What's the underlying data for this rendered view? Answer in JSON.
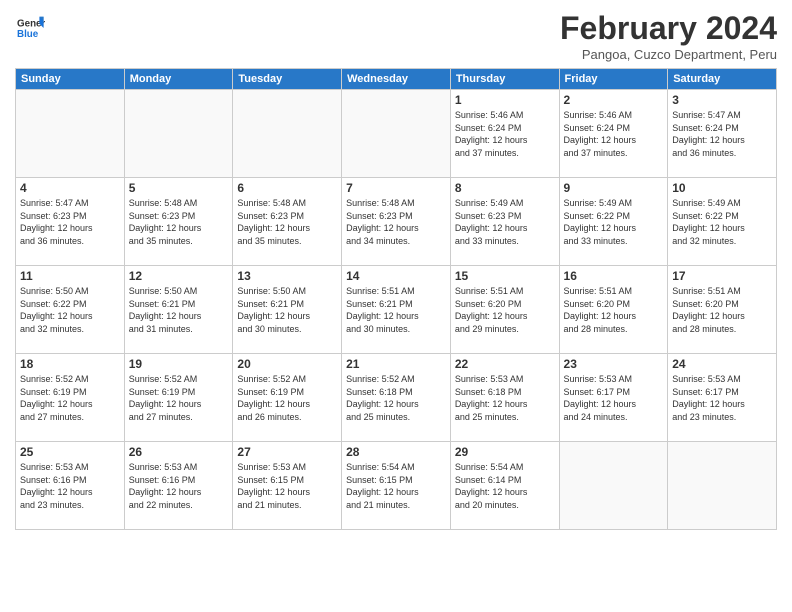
{
  "logo": {
    "line1": "General",
    "line2": "Blue",
    "icon_color": "#1a73d9"
  },
  "title": "February 2024",
  "subtitle": "Pangoa, Cuzco Department, Peru",
  "days_of_week": [
    "Sunday",
    "Monday",
    "Tuesday",
    "Wednesday",
    "Thursday",
    "Friday",
    "Saturday"
  ],
  "weeks": [
    [
      {
        "day": "",
        "info": ""
      },
      {
        "day": "",
        "info": ""
      },
      {
        "day": "",
        "info": ""
      },
      {
        "day": "",
        "info": ""
      },
      {
        "day": "1",
        "info": "Sunrise: 5:46 AM\nSunset: 6:24 PM\nDaylight: 12 hours\nand 37 minutes."
      },
      {
        "day": "2",
        "info": "Sunrise: 5:46 AM\nSunset: 6:24 PM\nDaylight: 12 hours\nand 37 minutes."
      },
      {
        "day": "3",
        "info": "Sunrise: 5:47 AM\nSunset: 6:24 PM\nDaylight: 12 hours\nand 36 minutes."
      }
    ],
    [
      {
        "day": "4",
        "info": "Sunrise: 5:47 AM\nSunset: 6:23 PM\nDaylight: 12 hours\nand 36 minutes."
      },
      {
        "day": "5",
        "info": "Sunrise: 5:48 AM\nSunset: 6:23 PM\nDaylight: 12 hours\nand 35 minutes."
      },
      {
        "day": "6",
        "info": "Sunrise: 5:48 AM\nSunset: 6:23 PM\nDaylight: 12 hours\nand 35 minutes."
      },
      {
        "day": "7",
        "info": "Sunrise: 5:48 AM\nSunset: 6:23 PM\nDaylight: 12 hours\nand 34 minutes."
      },
      {
        "day": "8",
        "info": "Sunrise: 5:49 AM\nSunset: 6:23 PM\nDaylight: 12 hours\nand 33 minutes."
      },
      {
        "day": "9",
        "info": "Sunrise: 5:49 AM\nSunset: 6:22 PM\nDaylight: 12 hours\nand 33 minutes."
      },
      {
        "day": "10",
        "info": "Sunrise: 5:49 AM\nSunset: 6:22 PM\nDaylight: 12 hours\nand 32 minutes."
      }
    ],
    [
      {
        "day": "11",
        "info": "Sunrise: 5:50 AM\nSunset: 6:22 PM\nDaylight: 12 hours\nand 32 minutes."
      },
      {
        "day": "12",
        "info": "Sunrise: 5:50 AM\nSunset: 6:21 PM\nDaylight: 12 hours\nand 31 minutes."
      },
      {
        "day": "13",
        "info": "Sunrise: 5:50 AM\nSunset: 6:21 PM\nDaylight: 12 hours\nand 30 minutes."
      },
      {
        "day": "14",
        "info": "Sunrise: 5:51 AM\nSunset: 6:21 PM\nDaylight: 12 hours\nand 30 minutes."
      },
      {
        "day": "15",
        "info": "Sunrise: 5:51 AM\nSunset: 6:20 PM\nDaylight: 12 hours\nand 29 minutes."
      },
      {
        "day": "16",
        "info": "Sunrise: 5:51 AM\nSunset: 6:20 PM\nDaylight: 12 hours\nand 28 minutes."
      },
      {
        "day": "17",
        "info": "Sunrise: 5:51 AM\nSunset: 6:20 PM\nDaylight: 12 hours\nand 28 minutes."
      }
    ],
    [
      {
        "day": "18",
        "info": "Sunrise: 5:52 AM\nSunset: 6:19 PM\nDaylight: 12 hours\nand 27 minutes."
      },
      {
        "day": "19",
        "info": "Sunrise: 5:52 AM\nSunset: 6:19 PM\nDaylight: 12 hours\nand 27 minutes."
      },
      {
        "day": "20",
        "info": "Sunrise: 5:52 AM\nSunset: 6:19 PM\nDaylight: 12 hours\nand 26 minutes."
      },
      {
        "day": "21",
        "info": "Sunrise: 5:52 AM\nSunset: 6:18 PM\nDaylight: 12 hours\nand 25 minutes."
      },
      {
        "day": "22",
        "info": "Sunrise: 5:53 AM\nSunset: 6:18 PM\nDaylight: 12 hours\nand 25 minutes."
      },
      {
        "day": "23",
        "info": "Sunrise: 5:53 AM\nSunset: 6:17 PM\nDaylight: 12 hours\nand 24 minutes."
      },
      {
        "day": "24",
        "info": "Sunrise: 5:53 AM\nSunset: 6:17 PM\nDaylight: 12 hours\nand 23 minutes."
      }
    ],
    [
      {
        "day": "25",
        "info": "Sunrise: 5:53 AM\nSunset: 6:16 PM\nDaylight: 12 hours\nand 23 minutes."
      },
      {
        "day": "26",
        "info": "Sunrise: 5:53 AM\nSunset: 6:16 PM\nDaylight: 12 hours\nand 22 minutes."
      },
      {
        "day": "27",
        "info": "Sunrise: 5:53 AM\nSunset: 6:15 PM\nDaylight: 12 hours\nand 21 minutes."
      },
      {
        "day": "28",
        "info": "Sunrise: 5:54 AM\nSunset: 6:15 PM\nDaylight: 12 hours\nand 21 minutes."
      },
      {
        "day": "29",
        "info": "Sunrise: 5:54 AM\nSunset: 6:14 PM\nDaylight: 12 hours\nand 20 minutes."
      },
      {
        "day": "",
        "info": ""
      },
      {
        "day": "",
        "info": ""
      }
    ]
  ]
}
